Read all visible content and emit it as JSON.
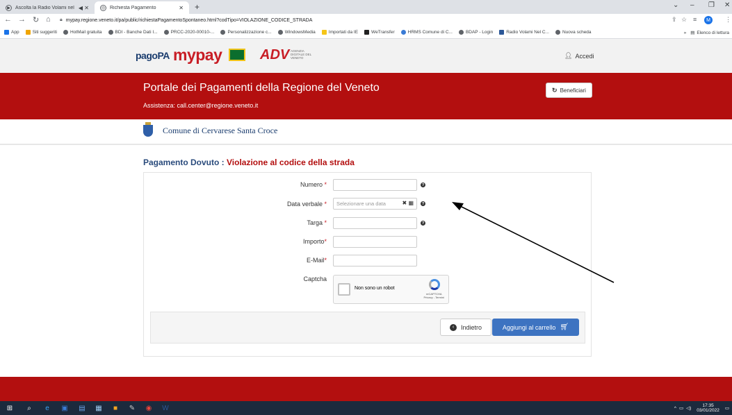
{
  "browser": {
    "tabs": [
      {
        "label": "Ascolta la Radio Volami nel c",
        "icon": "play-icon"
      },
      {
        "label": "Richiesta Pagamento",
        "icon": "globe-icon"
      }
    ],
    "url": "mypay.regione.veneto.it/pa/public/richiestaPagamentoSpontaneo.html?codTipo=VIOLAZIONE_CODICE_STRADA",
    "profile_initial": "M",
    "bookmarks": [
      "App",
      "Siti suggeriti",
      "HotMail gratuita",
      "BDI - Banche Dati I...",
      "PRCC-2020-00010-...",
      "Personalizzazione c...",
      "WindowsMedia",
      "Importati da IE",
      "WeTransfer",
      "HRMS Comune di C...",
      "BDAP - Login",
      "Radio Volami Nel C...",
      "Nuova scheda"
    ],
    "reading_list": "Elenco di lettura"
  },
  "header": {
    "logo_pagopa": "pagoPA",
    "logo_mypay": "mypay",
    "logo_adv": "ADV",
    "logo_adv_sub": "AGENZIA DIGITALE DEL VENETO",
    "login_label": "Accedi",
    "portal_title": "Portale dei Pagamenti della Regione del Veneto",
    "portal_assist": "Assistenza: call.center@regione.veneto.it",
    "beneficiari_label": "Beneficiari",
    "comune_name": "Comune di Cervarese Santa Croce"
  },
  "page": {
    "heading_prefix": "Pagamento Dovuto : ",
    "heading_accent": "Violazione al codice della strada"
  },
  "form": {
    "numero_label": "Numero",
    "data_label": "Data verbale",
    "data_placeholder": "Selezionare una data",
    "targa_label": "Targa",
    "importo_label": "Importo",
    "email_label": "E-Mail",
    "captcha_label": "Captcha",
    "captcha_text": "Non sono un robot",
    "captcha_brand": "reCAPTCHA",
    "captcha_links": "Privacy - Termini",
    "back_label": "Indietro",
    "cart_label": "Aggiungi al carrello"
  },
  "taskbar": {
    "time": "17:35",
    "date": "03/01/2022"
  }
}
